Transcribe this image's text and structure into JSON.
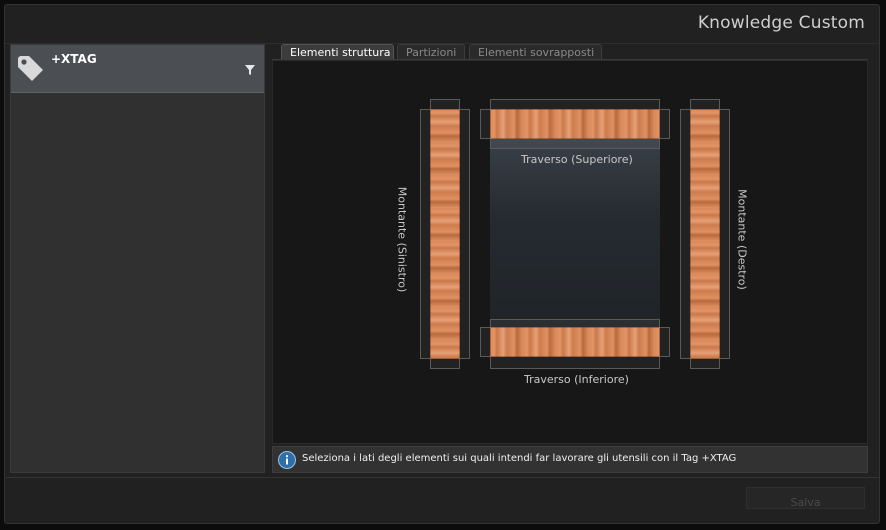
{
  "window": {
    "title": "Knowledge Custom"
  },
  "sidebar": {
    "tag": {
      "name": "+XTAG",
      "icon": "tag-icon",
      "filter_icon": "filter-icon"
    }
  },
  "tabs": [
    {
      "label": "Elementi struttura",
      "active": true
    },
    {
      "label": "Partizioni",
      "active": false
    },
    {
      "label": "Elementi sovrapposti",
      "active": false
    }
  ],
  "diagram": {
    "top_label": "Traverso (Superiore)",
    "bottom_label": "Traverso (Inferiore)",
    "left_label": "Montante (Sinistro)",
    "right_label": "Montante (Destro)"
  },
  "info": {
    "icon": "info-icon",
    "text": "Seleziona i lati degli elementi sui quali intendi far lavorare gli utensili con il Tag +XTAG"
  },
  "footer": {
    "save_label": "Salva"
  },
  "colors": {
    "wood": "#e09163",
    "accent_info": "#2f6ea8",
    "selected_tag_bg": "#4b4f54"
  }
}
